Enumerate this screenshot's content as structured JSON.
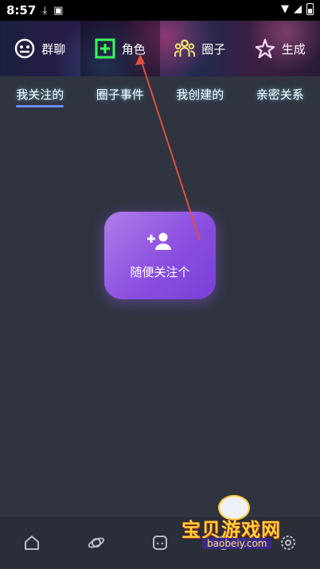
{
  "status": {
    "time": "8:57"
  },
  "hero_tabs": [
    {
      "label": "群聊",
      "icon": "group-chat-icon"
    },
    {
      "label": "角色",
      "icon": "add-square-icon"
    },
    {
      "label": "圈子",
      "icon": "people-icon"
    },
    {
      "label": "生成",
      "icon": "sparkle-star-icon"
    }
  ],
  "sub_tabs": [
    {
      "label": "我关注的"
    },
    {
      "label": "圈子事件"
    },
    {
      "label": "我创建的"
    },
    {
      "label": "亲密关系"
    }
  ],
  "follow_card": {
    "label": "随便关注个",
    "icon": "person-add-icon"
  },
  "bottom_nav": [
    {
      "icon": "home-icon"
    },
    {
      "icon": "planet-icon"
    },
    {
      "icon": "chat-icon"
    },
    {
      "icon": "discover-icon"
    },
    {
      "icon": "settings-icon"
    }
  ],
  "watermark": {
    "title": "宝贝游戏网",
    "url": "baobeiy.com"
  },
  "colors": {
    "accent": "#6b8cff",
    "card": "#8a4fe0",
    "arrow": "#e0503c"
  }
}
